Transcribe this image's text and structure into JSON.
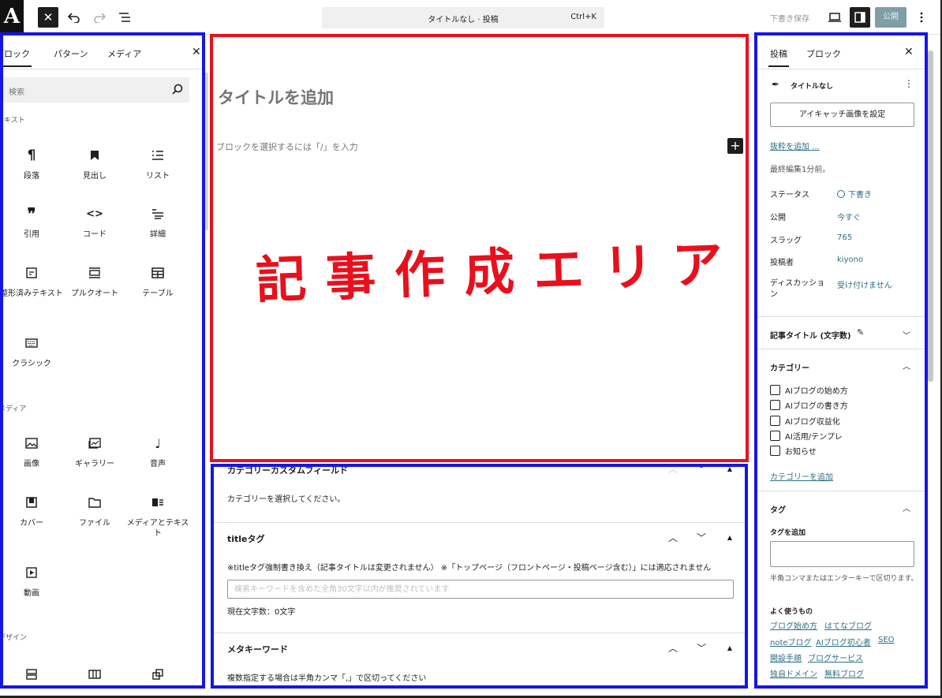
{
  "topbar": {
    "logo": "A",
    "command_title": "タイトルなし · 投稿",
    "command_shortcut": "Ctrl+K",
    "save_draft": "下書き保存",
    "publish": "公開"
  },
  "inserter": {
    "tabs": [
      "ブロック",
      "パターン",
      "メディア"
    ],
    "search_placeholder": "検索",
    "categories": {
      "text": "テキスト",
      "media": "メディア",
      "design": "デザイン"
    },
    "text_blocks": [
      {
        "label": "段落",
        "icon": "paragraph-icon"
      },
      {
        "label": "見出し",
        "icon": "bookmark-icon"
      },
      {
        "label": "リスト",
        "icon": "list-icon"
      },
      {
        "label": "引用",
        "icon": "quote-icon"
      },
      {
        "label": "コード",
        "icon": "code-icon"
      },
      {
        "label": "詳細",
        "icon": "details-icon"
      },
      {
        "label": "整形済みテキスト",
        "icon": "preformatted-icon"
      },
      {
        "label": "プルクオート",
        "icon": "pullquote-icon"
      },
      {
        "label": "テーブル",
        "icon": "table-icon"
      },
      {
        "label": "クラシック",
        "icon": "keyboard-icon"
      }
    ],
    "media_blocks": [
      {
        "label": "画像",
        "icon": "image-icon"
      },
      {
        "label": "ギャラリー",
        "icon": "gallery-icon"
      },
      {
        "label": "音声",
        "icon": "audio-icon"
      },
      {
        "label": "カバー",
        "icon": "cover-icon"
      },
      {
        "label": "ファイル",
        "icon": "folder-icon"
      },
      {
        "label": "メディアとテキスト",
        "icon": "media-text-icon"
      },
      {
        "label": "動画",
        "icon": "video-icon"
      }
    ]
  },
  "editor": {
    "title_placeholder": "タイトルを追加",
    "block_prompt": "ブロックを選択するには「/」を入力",
    "area_label": "記事作成エリア"
  },
  "metaboxes": {
    "category_field": {
      "title": "カテゴリーカスタムフィールド",
      "text": "カテゴリーを選択してください。"
    },
    "title_tag": {
      "title": "titleタグ",
      "note": "※titleタグ強制書き換え（記事タイトルは変更されません） ※「トップページ（フロントページ・投稿ページ含む）」には適応されません",
      "placeholder": "検索キーワードを含めた全角30文字以内が推奨されています",
      "count": "現在文字数：0文字"
    },
    "meta_keywords": {
      "title": "メタキーワード",
      "text": "複数指定する場合は半角カンマ「,」で区切ってください"
    }
  },
  "sidebar": {
    "tabs": [
      "投稿",
      "ブロック"
    ],
    "post_title": "タイトルなし",
    "featured_image_button": "アイキャッチ画像を設定",
    "add_excerpt": "抜粋を追加 ...",
    "last_edited": "最終編集1分前。",
    "rows": [
      {
        "label": "ステータス",
        "value": "下書き"
      },
      {
        "label": "公開",
        "value": "今すぐ"
      },
      {
        "label": "スラッグ",
        "value": "765"
      },
      {
        "label": "投稿者",
        "value": "kiyono"
      },
      {
        "label": "ディスカッション",
        "value": "受け付けません"
      }
    ],
    "article_title_panel": "記事タイトル (文字数)",
    "category_panel": {
      "title": "カテゴリー",
      "items": [
        "AIブログの始め方",
        "AIブログの書き方",
        "AIブログ収益化",
        "AI活用/テンプレ",
        "お知らせ"
      ],
      "add_link": "カテゴリーを追加"
    },
    "tag_panel": {
      "title": "タグ",
      "add_label": "タグを追加",
      "help": "半角コンマまたはエンターキーで区切ります。",
      "frequent_label": "よく使うもの",
      "frequent": [
        "ブログ始め方",
        "はてなブログ",
        "noteブログ",
        "AIブログ初心者",
        "SEO",
        "開設手順",
        "ブログサービス",
        "独自ドメイン",
        "無料ブログ"
      ]
    }
  },
  "colors": {
    "highlight_blue": "#1616e6",
    "highlight_red": "#e8101c",
    "link": "#2e6f83",
    "publish_bg": "#7f9ea6"
  }
}
